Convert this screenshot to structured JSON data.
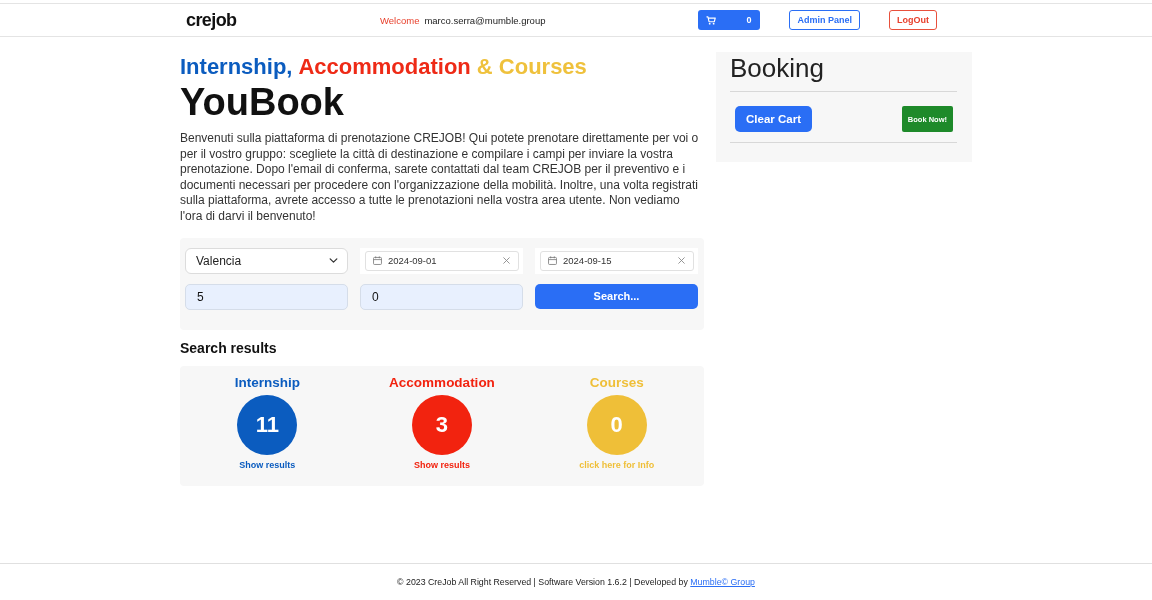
{
  "header": {
    "logo": "crejob",
    "welcome_label": "Welcome",
    "user_email": "marco.serra@mumble.group",
    "cart": {
      "count": "0"
    },
    "buttons": [
      {
        "label": "Admin Panel",
        "kind": "info"
      },
      {
        "label": "LogOut",
        "kind": "danger"
      }
    ]
  },
  "hero": {
    "tagline": [
      {
        "text": "Internship,",
        "color": "#0b5cbf"
      },
      {
        "text": "Accommodation",
        "color": "#ee2a16"
      },
      {
        "text": "& Courses",
        "color": "#efc13c"
      }
    ],
    "title": "YouBook",
    "intro": "Benvenuti sulla piattaforma di prenotazione CREJOB! Qui potete prenotare direttamente per voi o per il vostro gruppo: scegliete la città di destinazione e compilare i campi per inviare la vostra prenotazione. Dopo l'email di conferma, sarete contattati dal team CREJOB per il preventivo e i documenti necessari per procedere con l'organizzazione della mobilità. Inoltre, una volta registrati sulla piattaforma, avrete accesso a tutte le prenotazioni nella vostra area utente. Non vediamo l'ora di darvi il benvenuto!"
  },
  "search_form": {
    "city": "Valencia",
    "date_from": "2024-09-01",
    "date_to": "2024-09-15",
    "inputs": [
      {
        "value": "5"
      },
      {
        "value": "0"
      }
    ],
    "submit": "Search..."
  },
  "search_results": {
    "heading": "Search results",
    "categories": [
      {
        "label": "Internship",
        "count": "11",
        "link": "Show results",
        "color": "#0b5cbf"
      },
      {
        "label": "Accommodation",
        "count": "3",
        "link": "Show results",
        "color": "#f2230f"
      },
      {
        "label": "Courses",
        "count": "0",
        "link": "click here for Info",
        "color": "#efbf38"
      }
    ]
  },
  "booking": {
    "title": "Booking",
    "buttons": [
      {
        "label": "Clear Cart",
        "kind": "primary"
      },
      {
        "label": "Book Now!",
        "kind": "success"
      }
    ]
  },
  "footer": {
    "text": "© 2023 CreJob All Right Reserved | Software Version 1.6.2 | Developed by",
    "link": "Mumble© Group"
  }
}
